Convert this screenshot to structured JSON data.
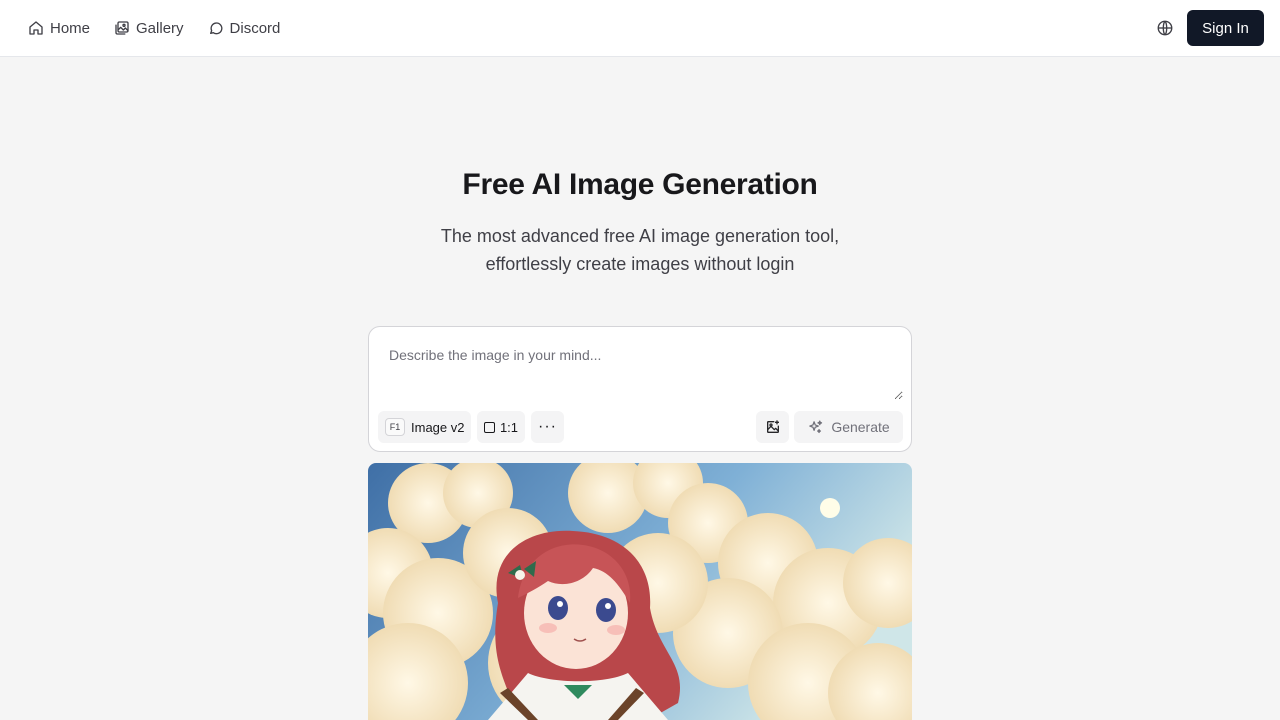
{
  "nav": {
    "items": [
      {
        "label": "Home",
        "icon": "home-icon"
      },
      {
        "label": "Gallery",
        "icon": "gallery-icon"
      },
      {
        "label": "Discord",
        "icon": "chat-bubble-icon"
      }
    ],
    "language_icon": "globe-icon",
    "signin_label": "Sign In"
  },
  "hero": {
    "title": "Free AI Image Generation",
    "subtitle": "The most advanced free AI image generation tool, effortlessly create images without login"
  },
  "prompt": {
    "placeholder": "Describe the image in your mind...",
    "value": ""
  },
  "toolbar": {
    "model_badge": "F1",
    "model_label": "Image v2",
    "ratio_label": "1:1",
    "more_label": "···",
    "upload_icon": "image-upload-icon",
    "generate_label": "Generate",
    "generate_icon": "sparkles-icon"
  },
  "colors": {
    "page_bg": "#f5f5f5",
    "primary_button": "#111827",
    "sky": "#4a7fb5"
  }
}
